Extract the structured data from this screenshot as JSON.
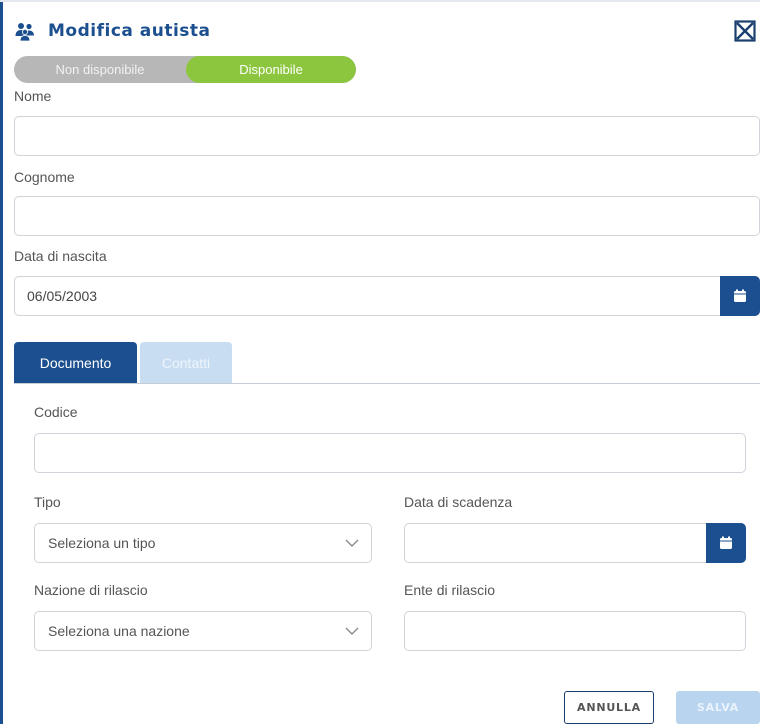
{
  "dialog": {
    "title": "Modifica autista",
    "header_icon": "users-icon",
    "close_icon": "close-icon",
    "accent_color": "#1b4f8f"
  },
  "availability": {
    "off_label": "Non disponibile",
    "on_label": "Disponibile",
    "selected": "Disponibile",
    "on_color": "#8cc63f",
    "off_color": "#b7b7b7"
  },
  "form": {
    "nome": {
      "label": "Nome",
      "value": ""
    },
    "cognome": {
      "label": "Cognome",
      "value": ""
    },
    "data_nascita": {
      "label": "Data di nascita",
      "value": "06/05/2003",
      "icon": "calendar-icon"
    }
  },
  "tabs": [
    {
      "label": "Documento",
      "active": true
    },
    {
      "label": "Contatti",
      "active": false
    }
  ],
  "documento": {
    "codice": {
      "label": "Codice",
      "value": ""
    },
    "tipo": {
      "label": "Tipo",
      "selected": "Seleziona un tipo",
      "icon": "chevron-down-icon"
    },
    "data_scadenza": {
      "label": "Data di scadenza",
      "value": "",
      "icon": "calendar-icon"
    },
    "nazione_rilascio": {
      "label": "Nazione di rilascio",
      "selected": "Seleziona una nazione",
      "icon": "chevron-down-icon"
    },
    "ente_rilascio": {
      "label": "Ente di rilascio",
      "value": ""
    }
  },
  "actions": {
    "cancel_label": "ANNULLA",
    "save_label": "SALVA"
  }
}
